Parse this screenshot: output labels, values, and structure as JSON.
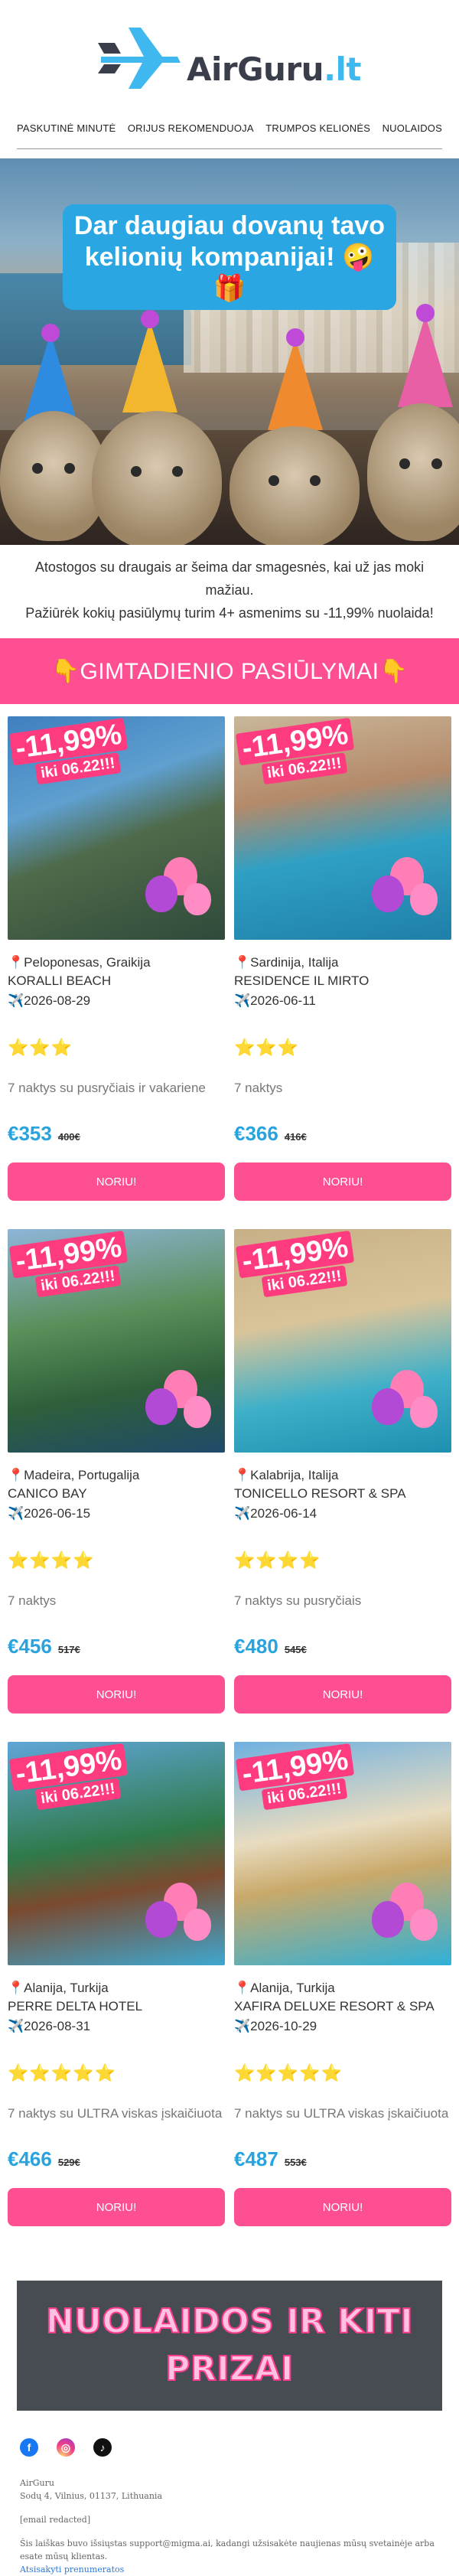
{
  "brand": {
    "name": "AirGuru",
    "suffix": ".lt"
  },
  "nav": [
    "PASKUTINĖ MINUTĖ",
    "ORIJUS REKOMENDUOJA",
    "TRUMPOS KELIONĖS",
    "NUOLAIDOS"
  ],
  "hero": {
    "banner": "Dar daugiau dovanų tavo kelionių kompanijai! 🤪🎁"
  },
  "intro": {
    "line1": "Atostogos su draugais ar šeima dar smagesnės, kai už jas moki mažiau.",
    "line2": "Pažiūrėk kokių pasiūlymų turim 4+ asmenims su -11,99% nuolaida!"
  },
  "section_title": "👇GIMTADIENIO PASIŪLYMAI👇",
  "discount": {
    "percent": "-11,99%",
    "until": "iki 06.22!!!"
  },
  "offers": [
    {
      "location": "📍Peloponesas, Graikija",
      "hotel": "KORALLI BEACH",
      "date": "✈️2026-08-29",
      "stars": "⭐⭐⭐",
      "nights": "7 naktys su pusryčiais ir vakariene",
      "price": "€353",
      "old_price": "400€",
      "button": "NORIU!"
    },
    {
      "location": "📍Sardinija, Italija",
      "hotel": "RESIDENCE IL MIRTO",
      "date": "✈️2026-06-11",
      "stars": "⭐⭐⭐",
      "nights": "7 naktys",
      "price": "€366",
      "old_price": "416€",
      "button": "NORIU!"
    },
    {
      "location": "📍Madeira, Portugalija",
      "hotel": "CANICO BAY",
      "date": "✈️2026-06-15",
      "stars": "⭐⭐⭐⭐",
      "nights": "7 naktys",
      "price": "€456",
      "old_price": "517€",
      "button": "NORIU!"
    },
    {
      "location": "📍Kalabrija, Italija",
      "hotel": "TONICELLO RESORT & SPA",
      "date": "✈️2026-06-14",
      "stars": "⭐⭐⭐⭐",
      "nights": "7 naktys su pusryčiais",
      "price": "€480",
      "old_price": "545€",
      "button": "NORIU!"
    },
    {
      "location": "📍Alanija, Turkija",
      "hotel": "PERRE DELTA HOTEL",
      "date": "✈️2026-08-31",
      "stars": "⭐⭐⭐⭐⭐",
      "nights": "7 naktys su ULTRA viskas įskaičiuota",
      "price": "€466",
      "old_price": "529€",
      "button": "NORIU!"
    },
    {
      "location": "📍Alanija, Turkija",
      "hotel": "XAFIRA DELUXE RESORT & SPA",
      "date": "✈️2026-10-29",
      "stars": "⭐⭐⭐⭐⭐",
      "nights": "7 naktys su ULTRA viskas įskaičiuota",
      "price": "€487",
      "old_price": "553€",
      "button": "NORIU!"
    }
  ],
  "promo": {
    "line1": "NUOLAIDOS IR KITI",
    "line2": "PRIZAI"
  },
  "social": {
    "facebook": "f",
    "instagram": "◎",
    "tiktok": "♪"
  },
  "footer": {
    "company": "AirGuru",
    "address": "Sodų 4, Vilnius, 01137, Lithuania",
    "email": "[email redacted]",
    "notice": "Šis laiškas buvo išsiųstas support@migma.ai, kadangi užsisakėte naujienas mūsų svetainėje arba esate mūsų klientas.",
    "unsubscribe": "Atsisakyti prenumeratos"
  },
  "colors": {
    "accent": "#ff4f93",
    "price": "#29a3dd",
    "brand_blue": "#3fb8f0",
    "promo_bg": "#474b52"
  }
}
